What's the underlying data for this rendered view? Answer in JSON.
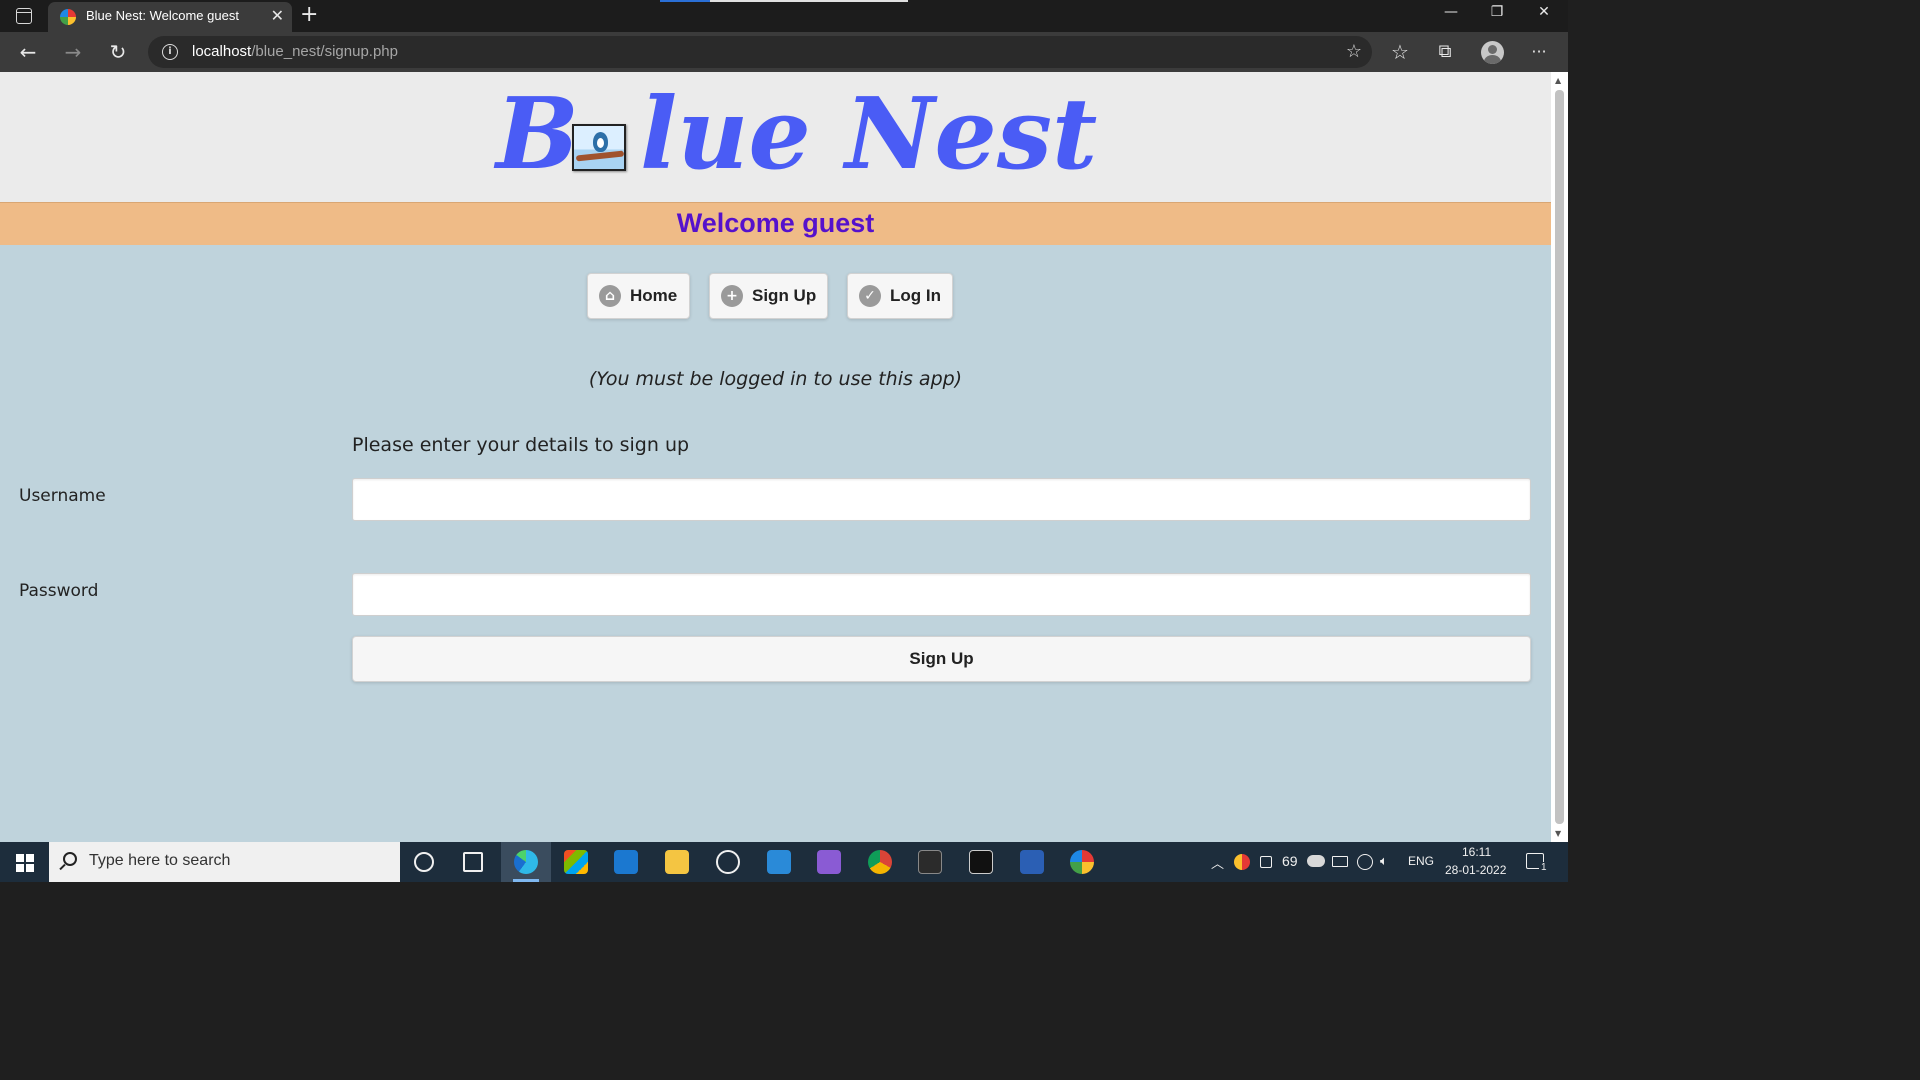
{
  "browser": {
    "tab_title": "Blue Nest: Welcome guest",
    "tab_close": "✕",
    "new_tab": "+",
    "url_host": "localhost",
    "url_path": "/blue_nest/signup.php",
    "window_controls": {
      "minimize": "—",
      "restore": "❐",
      "close": "✕"
    },
    "nav_icons": {
      "back": "←",
      "forward": "→",
      "refresh": "↻",
      "favorites": "☆",
      "collections": "⧉",
      "more": "···"
    }
  },
  "site": {
    "logo_first": "B",
    "logo_rest": "lue Nest",
    "welcome": "Welcome guest",
    "nav": [
      {
        "label": "Home",
        "icon": "home-icon",
        "glyph": "⌂"
      },
      {
        "label": "Sign Up",
        "icon": "plus-icon",
        "glyph": "+"
      },
      {
        "label": "Log In",
        "icon": "check-icon",
        "glyph": "✓"
      }
    ],
    "info_message": "(You must be logged in to use this app)",
    "form": {
      "heading": "Please enter your details to sign up",
      "username_label": "Username",
      "username_value": "",
      "password_label": "Password",
      "password_value": "",
      "submit_label": "Sign Up"
    },
    "colors": {
      "logo": "#4a5cf5",
      "welcome_band": "#efbb87",
      "welcome_text": "#5511cc",
      "page_background": "#bfd3dc"
    }
  },
  "taskbar": {
    "search_placeholder": "Type here to search",
    "battery_or_temp": "69",
    "language": "ENG",
    "time": "16:11",
    "date": "28-01-2022",
    "notifications": "1"
  }
}
